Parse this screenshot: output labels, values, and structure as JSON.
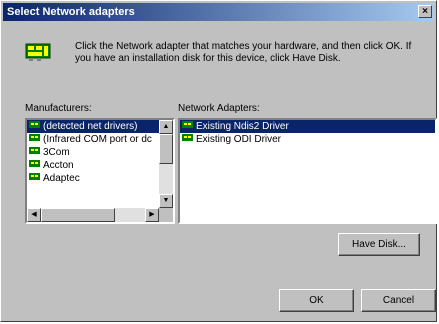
{
  "window": {
    "title": "Select Network adapters",
    "close_label": "×"
  },
  "intro": {
    "text": "Click the Network adapter that matches your hardware, and then click OK. If you have an installation disk for this device, click Have Disk."
  },
  "manufacturers": {
    "label": "Manufacturers:",
    "items": [
      {
        "label": "(detected net drivers)",
        "selected": true
      },
      {
        "label": "(Infrared COM port or dc",
        "selected": false
      },
      {
        "label": "3Com",
        "selected": false
      },
      {
        "label": "Accton",
        "selected": false
      },
      {
        "label": "Adaptec",
        "selected": false
      }
    ]
  },
  "adapters": {
    "label": "Network Adapters:",
    "items": [
      {
        "label": "Existing Ndis2 Driver",
        "selected": true
      },
      {
        "label": "Existing ODI Driver",
        "selected": false
      }
    ]
  },
  "buttons": {
    "have_disk": "Have Disk...",
    "ok": "OK",
    "cancel": "Cancel"
  },
  "colors": {
    "titlebar_start": "#0a246a",
    "selection": "#0a246a",
    "face": "#c0c0c0"
  }
}
